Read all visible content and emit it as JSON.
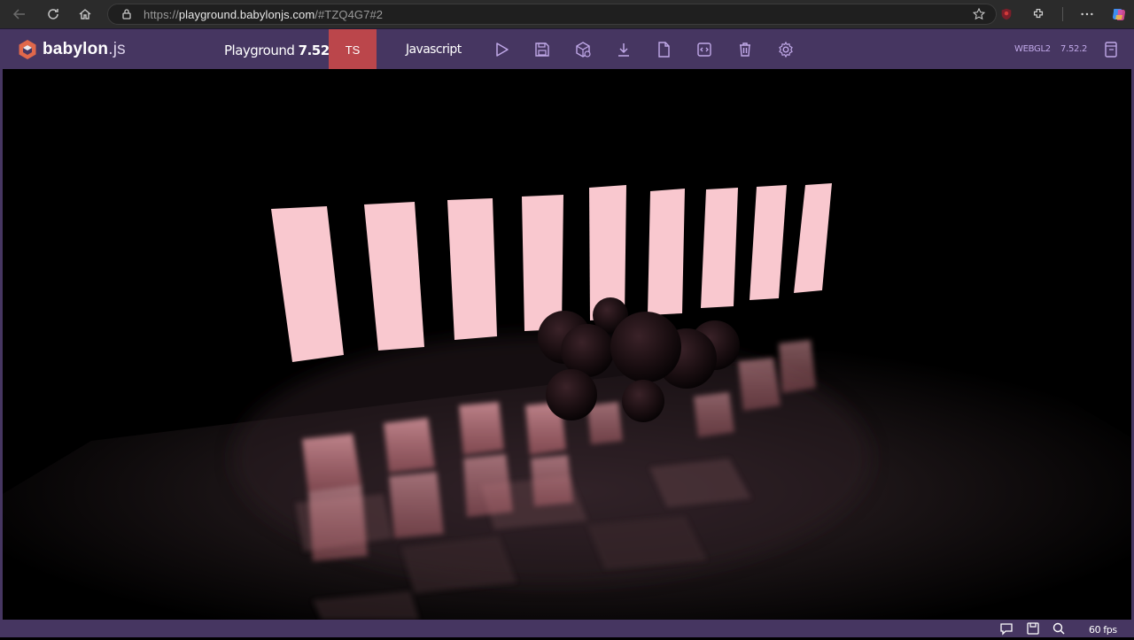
{
  "browser": {
    "url_prefix": "https://",
    "url_host": "playground.babylonjs.com",
    "url_path": "/#TZQ4G7#2"
  },
  "header": {
    "logo_brand": "babylon",
    "logo_suffix": ".js",
    "playground_label": "Playground",
    "playground_version": "7.52.2",
    "tab_ts": "TS",
    "tab_js": "Javascript",
    "engine_label": "WEBGL2",
    "engine_version": "7.52.2",
    "icons": [
      "play-icon",
      "save-icon",
      "inspector-icon",
      "download-icon",
      "new-file-icon",
      "clear-icon",
      "delete-icon",
      "settings-icon",
      "examples-icon"
    ]
  },
  "footer": {
    "fps_text": "60 fps",
    "icons": [
      "comment-icon",
      "save-small-icon",
      "search-icon"
    ]
  },
  "colors": {
    "header_bg": "#463661",
    "ts_tab_bg": "#bb464b",
    "accent_icon": "#c0a8e8",
    "light_panel": "#f9c8cf"
  }
}
